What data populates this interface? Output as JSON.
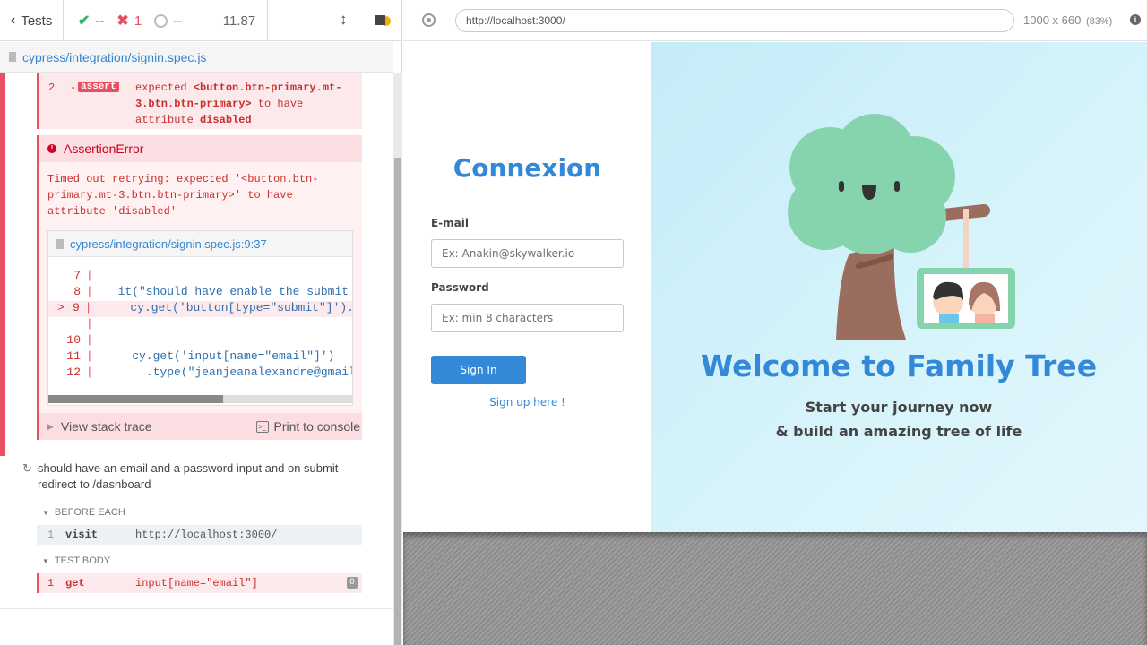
{
  "topbar": {
    "tests_label": "Tests",
    "passed": "--",
    "failed": "1",
    "pending": "--",
    "duration": "11.87"
  },
  "spec": {
    "path": "cypress/integration/signin.spec.js"
  },
  "command_assert": {
    "num": "2",
    "dash": "-",
    "badge": "assert",
    "message_pre": "expected",
    "message_sel": "<button.btn-primary.mt-3.btn.btn-primary>",
    "message_mid": "to have attribute",
    "message_val": "disabled"
  },
  "error": {
    "title": "AssertionError",
    "message": "Timed out retrying: expected '<button.btn-primary.mt-3.btn.btn-primary>' to have attribute 'disabled'",
    "file_link": "cypress/integration/signin.spec.js:9:37",
    "code_lines": [
      {
        "num": "7",
        "marker": "",
        "text": ""
      },
      {
        "num": "8",
        "marker": "",
        "text": "  it(\"should have enable the submit"
      },
      {
        "num": "9",
        "marker": ">",
        "text": "    cy.get('button[type=\"submit\"]')."
      },
      {
        "num": "",
        "marker": "",
        "text": ""
      },
      {
        "num": "10",
        "marker": "",
        "text": ""
      },
      {
        "num": "11",
        "marker": "",
        "text": "    cy.get('input[name=\"email\"]')"
      },
      {
        "num": "12",
        "marker": "",
        "text": "      .type(\"jeanjeanalexandre@gmail"
      }
    ],
    "view_stack": "View stack trace",
    "print_console": "Print to console"
  },
  "test2": {
    "title": "should have an email and a password input and on submit redirect to /dashboard",
    "before_each_label": "BEFORE EACH",
    "before_cmd": {
      "num": "1",
      "name": "visit",
      "arg": "http://localhost:3000/"
    },
    "body_label": "TEST BODY",
    "body_cmd": {
      "num": "1",
      "name": "get",
      "arg": "input[name=\"email\"]",
      "count": "0"
    }
  },
  "browser": {
    "url": "http://localhost:3000/",
    "viewport": "1000 x 660",
    "scale": "(83%)"
  },
  "app": {
    "brand": "Connexion",
    "email_label": "E-mail",
    "email_placeholder": "Ex: Anakin@skywalker.io",
    "password_label": "Password",
    "password_placeholder": "Ex: min 8 characters",
    "signin_button": "Sign In",
    "signup_link": "Sign up here !",
    "welcome": "Welcome to Family Tree",
    "tagline_1": "Start your journey now",
    "tagline_2": "& build an amazing tree of life"
  },
  "colors": {
    "pass": "#38b369",
    "fail": "#e94f5f",
    "brand_blue": "#3389d8",
    "hero_bg": "#d3f1fa",
    "tree_green": "#86d4ae"
  }
}
